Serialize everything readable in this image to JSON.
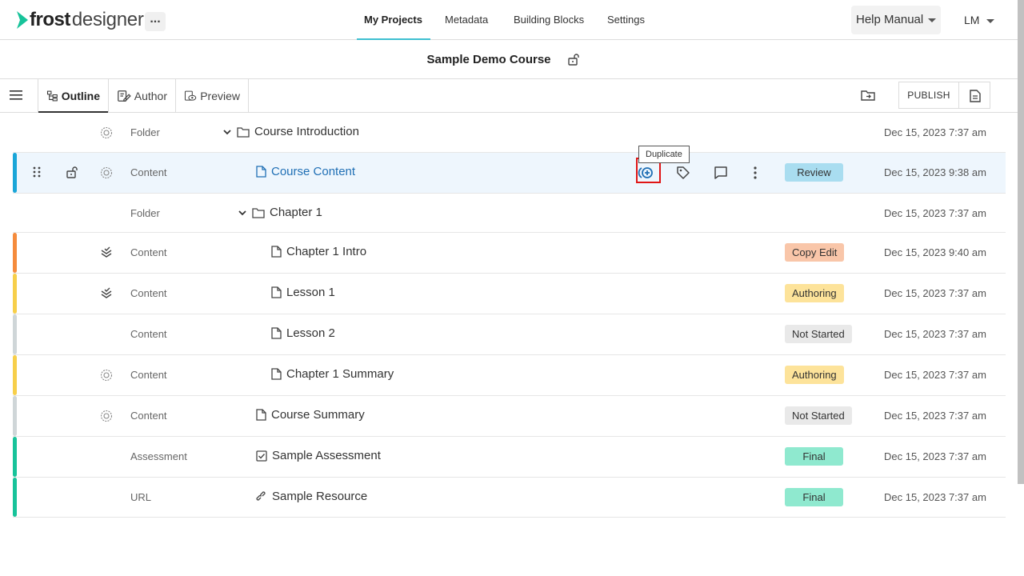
{
  "app": {
    "brand_bold": "frost",
    "brand_light": "designer",
    "more_label": "...",
    "user_initials": "LM"
  },
  "nav": {
    "items": [
      "My Projects",
      "Metadata",
      "Building Blocks",
      "Settings"
    ],
    "active": "My Projects",
    "help_label": "Help Manual"
  },
  "course": {
    "title": "Sample Demo Course"
  },
  "toolbar": {
    "tabs": [
      "Outline",
      "Author",
      "Preview"
    ],
    "publish_label": "PUBLISH"
  },
  "tooltip": "Duplicate",
  "rows": [
    {
      "type": "Folder",
      "name": "Course Introduction",
      "icon": "folder-icon",
      "expanded": true,
      "state_icon": "gear-badge-icon",
      "status": "",
      "date": "Dec 15, 2023 7:37 am",
      "stripe": ""
    },
    {
      "type": "Content",
      "name": "Course Content",
      "icon": "file-icon",
      "state_icon": "gear-badge-icon",
      "status": "Review",
      "date": "Dec 15, 2023 9:38 am",
      "stripe": "#1aa6d8",
      "selected": true
    },
    {
      "type": "Folder",
      "name": "Chapter 1",
      "icon": "folder-icon",
      "expanded": true,
      "state_icon": "",
      "status": "",
      "date": "Dec 15, 2023 7:37 am",
      "stripe": ""
    },
    {
      "type": "Content",
      "name": "Chapter 1 Intro",
      "icon": "file-icon",
      "state_icon": "layers-check-icon",
      "status": "Copy Edit",
      "date": "Dec 15, 2023 9:40 am",
      "stripe": "#f58b3c"
    },
    {
      "type": "Content",
      "name": "Lesson 1",
      "icon": "file-icon",
      "state_icon": "layers-check-icon",
      "status": "Authoring",
      "date": "Dec 15, 2023 7:37 am",
      "stripe": "#f7cf4a"
    },
    {
      "type": "Content",
      "name": "Lesson 2",
      "icon": "file-icon",
      "state_icon": "",
      "status": "Not Started",
      "date": "Dec 15, 2023 7:37 am",
      "stripe": "#cfd6d8"
    },
    {
      "type": "Content",
      "name": "Chapter 1 Summary",
      "icon": "file-icon",
      "state_icon": "gear-badge-icon",
      "status": "Authoring",
      "date": "Dec 15, 2023 7:37 am",
      "stripe": "#f7cf4a"
    },
    {
      "type": "Content",
      "name": "Course Summary",
      "icon": "file-icon",
      "state_icon": "gear-badge-icon",
      "status": "Not Started",
      "date": "Dec 15, 2023 7:37 am",
      "stripe": "#cfd6d8"
    },
    {
      "type": "Assessment",
      "name": "Sample Assessment",
      "icon": "checkbox-icon",
      "state_icon": "",
      "status": "Final",
      "date": "Dec 15, 2023 7:37 am",
      "stripe": "#17c39a"
    },
    {
      "type": "URL",
      "name": "Sample Resource",
      "icon": "link-icon",
      "state_icon": "",
      "status": "Final",
      "date": "Dec 15, 2023 7:37 am",
      "stripe": "#17c39a"
    }
  ],
  "status_colors": {
    "Review": "#a9ddf0",
    "Copy Edit": "#f9c6a9",
    "Authoring": "#fde39a",
    "Not Started": "#e9e9e9",
    "Final": "#8fe9cf"
  }
}
